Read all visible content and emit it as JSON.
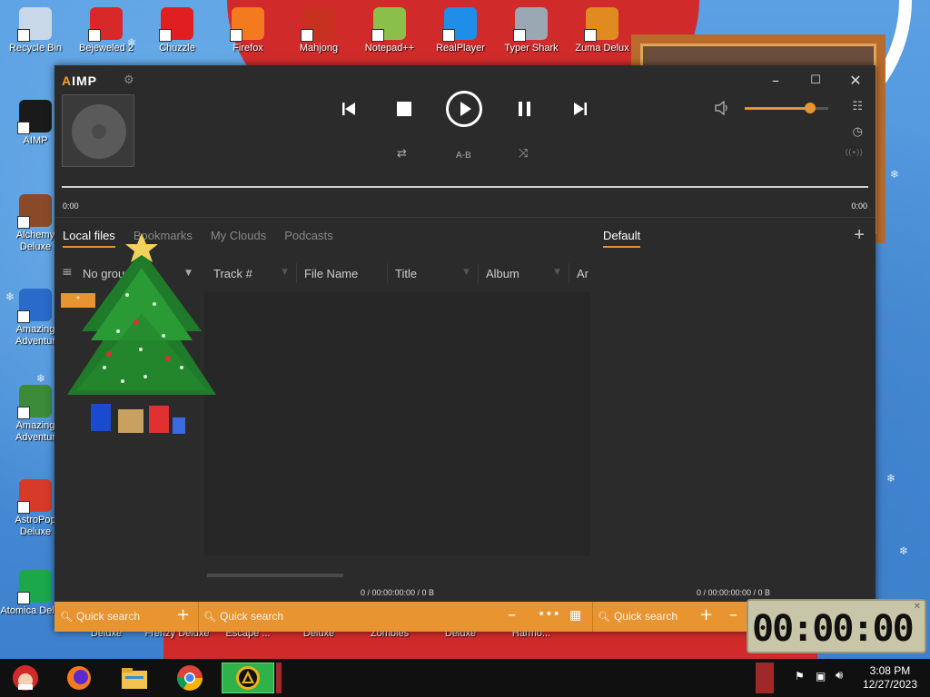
{
  "desktop": {
    "icons_top": [
      {
        "label": "Recycle Bin",
        "color": "#c8d8e8"
      },
      {
        "label": "Bejeweled 2",
        "color": "#d82828"
      },
      {
        "label": "Chuzzle",
        "color": "#e02020"
      },
      {
        "label": "Firefox",
        "color": "#f47a20"
      },
      {
        "label": "Mahjong",
        "color": "#c83020"
      },
      {
        "label": "Notepad++",
        "color": "#8ac04a"
      },
      {
        "label": "RealPlayer",
        "color": "#1e8ee8"
      },
      {
        "label": "Typer Shark",
        "color": "#9aa8b4"
      },
      {
        "label": "Zuma Delux",
        "color": "#e08a20"
      }
    ],
    "icons_left": [
      {
        "label": "AIMP",
        "color": "#1a1a1a"
      },
      {
        "label": "Alchemy Deluxe",
        "color": "#8a4a2a"
      },
      {
        "label": "Amazing Adventur",
        "color": "#2a6ac8"
      },
      {
        "label": "Amazing Adventur",
        "color": "#3a8a3a"
      },
      {
        "label": "AstroPop Deluxe",
        "color": "#d83a2a"
      },
      {
        "label": "Atomica Deluxe",
        "color": "#1aa84a"
      }
    ],
    "icons_bottom": [
      "Deluxe",
      "Frenzy Deluxe",
      "Escape ...",
      "Deluxe",
      "Zombies",
      "Deluxe",
      "Harmo..."
    ]
  },
  "aimp": {
    "logo": "IMP",
    "logo_accent": "A",
    "controls": {
      "repeat": "⇄",
      "ab": "A-B",
      "shuffle": "⤨"
    },
    "volume_level": 0.78,
    "time_left": "0:00",
    "time_right": "0:00",
    "tabs": [
      "Local files",
      "Bookmarks",
      "My Clouds",
      "Podcasts"
    ],
    "active_tab": "Local files",
    "playlist_tab": "Default",
    "columns": {
      "group": "No group",
      "track": "Track #",
      "file": "File Name",
      "title": "Title",
      "album": "Album",
      "artist": "Ar"
    },
    "group_chip": "*",
    "status_left": "0 / 00:00:00:00 / 0 B",
    "status_right": "0 / 00:00:00:00 / 0 B",
    "search_1": "Quick search",
    "search_2": "Quick search",
    "search_3": "Quick search"
  },
  "clock": {
    "digits": "00:00:00"
  },
  "taskbar": {
    "time": "3:08 PM",
    "date": "12/27/2023"
  }
}
